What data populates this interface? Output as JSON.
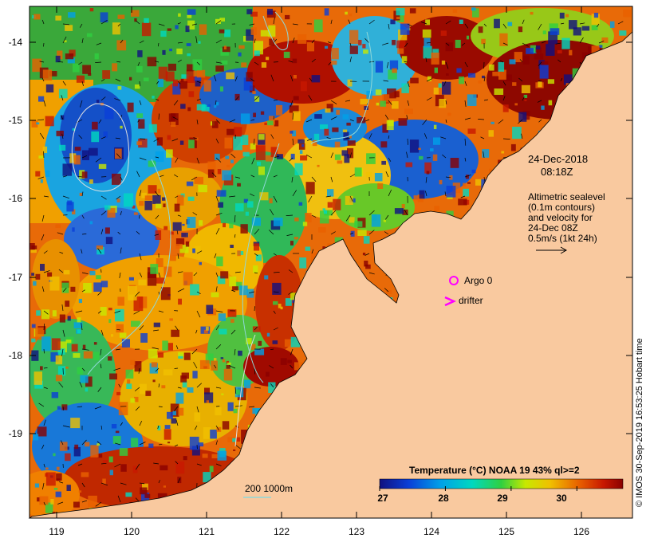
{
  "map": {
    "y_ticks": [
      "-14",
      "-15",
      "-16",
      "-17",
      "-18",
      "-19"
    ],
    "x_ticks": [
      "119",
      "120",
      "121",
      "122",
      "123",
      "124",
      "125",
      "126"
    ],
    "date_line1": "24-Dec-2018",
    "date_line2": "08:18Z",
    "legend_text": {
      "line1": "Altimetric sealevel",
      "line2": "(0.1m contours)",
      "line3": "and velocity for",
      "line4": "24-Dec 08Z",
      "line5": "0.5m/s (1kt 24h)"
    },
    "argo_label": "Argo 0",
    "drifter_label": "drifter",
    "depth_legend": "200  1000m",
    "colorbar": {
      "title": "Temperature (°C) NOAA 19 43% ql>=2",
      "ticks": [
        "27",
        "28",
        "29",
        "30"
      ],
      "tick_values": [
        27,
        28,
        29,
        30
      ],
      "range": [
        27,
        30.7
      ]
    },
    "credit": "© IMOS 30-Sep-2019 16:53:25 Hobart time",
    "colors": {
      "land": "#f9c99f",
      "argo": "#ff00ff",
      "drifter": "#ff00ff",
      "contour": "#8fd8d8"
    }
  }
}
